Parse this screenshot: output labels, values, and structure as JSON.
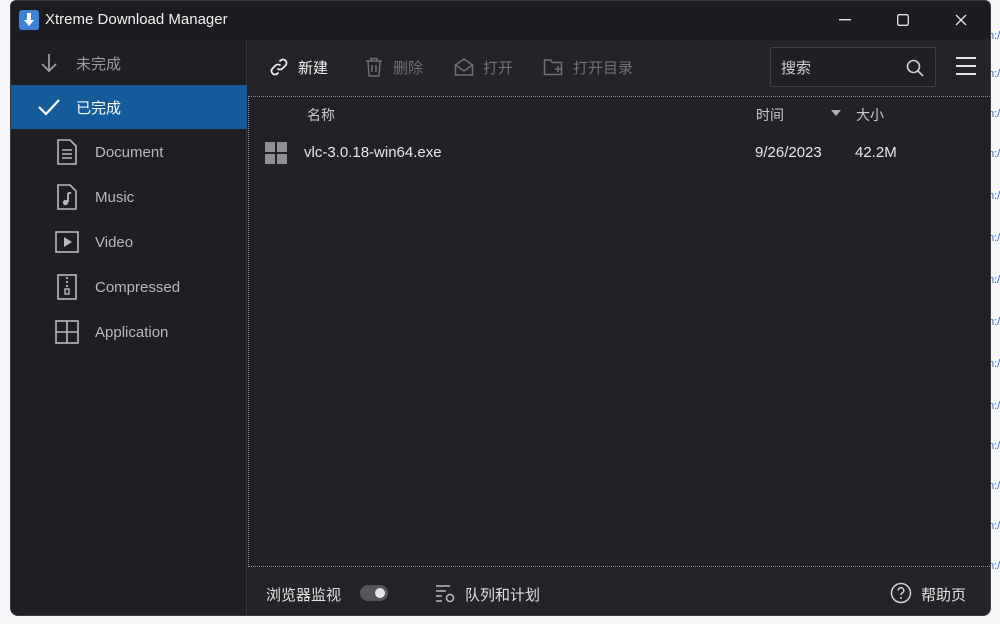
{
  "window": {
    "title": "Xtreme Download Manager"
  },
  "sidebar": {
    "items": [
      {
        "label": "未完成",
        "icon": "download-arrow-icon"
      },
      {
        "label": "已完成",
        "icon": "checkmark-icon",
        "active": true
      },
      {
        "label": "Document",
        "icon": "document-icon"
      },
      {
        "label": "Music",
        "icon": "music-file-icon"
      },
      {
        "label": "Video",
        "icon": "video-file-icon"
      },
      {
        "label": "Compressed",
        "icon": "zip-file-icon"
      },
      {
        "label": "Application",
        "icon": "application-grid-icon"
      }
    ]
  },
  "toolbar": {
    "new_label": "新建",
    "delete_label": "删除",
    "open_label": "打开",
    "open_folder_label": "打开目录",
    "search_placeholder": "搜索"
  },
  "file_list": {
    "columns": {
      "name": "名称",
      "time": "时间",
      "size": "大小"
    },
    "rows": [
      {
        "name": "vlc-3.0.18-win64.exe",
        "date": "9/26/2023",
        "size": "42.2M",
        "icon": "windows-app-icon"
      }
    ]
  },
  "statusbar": {
    "browser_monitor_label": "浏览器监视",
    "queue_label": "队列和计划",
    "help_label": "帮助页"
  },
  "colors": {
    "accent": "#135b9a",
    "background": "#212227",
    "sidebar": "#1e1f23"
  }
}
